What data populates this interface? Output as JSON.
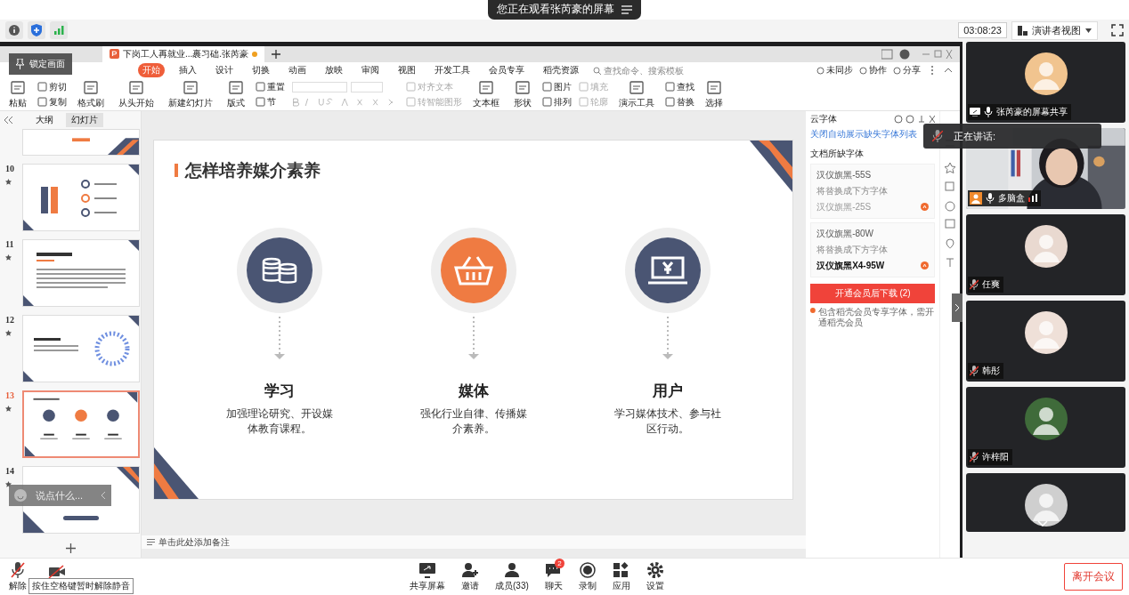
{
  "top_banner": {
    "text": "您正在观看张芮豪的屏幕"
  },
  "toolbar": {
    "time": "03:08:23",
    "view_button": "演讲者视图"
  },
  "lock_tooltip": "锁定画面",
  "wps": {
    "tabs": [
      {
        "label": "下岗工人再就业...裹习础.张芮豪",
        "selected": true
      }
    ],
    "menu": [
      {
        "label": "开始",
        "selected": true
      },
      {
        "label": "插入",
        "selected": false
      },
      {
        "label": "设计",
        "selected": false
      },
      {
        "label": "切换",
        "selected": false
      },
      {
        "label": "动画",
        "selected": false
      },
      {
        "label": "放映",
        "selected": false
      },
      {
        "label": "审阅",
        "selected": false
      },
      {
        "label": "视图",
        "selected": false
      },
      {
        "label": "开发工具",
        "selected": false
      },
      {
        "label": "会员专享",
        "selected": false
      },
      {
        "label": "稻壳资源",
        "selected": false
      }
    ],
    "search_placeholder": "查找命令、搜索模板",
    "header_actions": [
      "未同步",
      "协作",
      "分享"
    ],
    "ribbon": [
      {
        "kind": "large",
        "label": "粘贴",
        "disabled": false
      },
      {
        "kind": "stack",
        "items": [
          {
            "label": "剪切",
            "disabled": false
          },
          {
            "label": "复制",
            "disabled": false
          }
        ]
      },
      {
        "kind": "large",
        "label": "格式刷",
        "disabled": false
      },
      {
        "kind": "large",
        "label": "从头开始",
        "disabled": false
      },
      {
        "kind": "large",
        "label": "新建幻灯片",
        "disabled": false
      },
      {
        "kind": "large",
        "label": "版式",
        "disabled": false
      },
      {
        "kind": "stack",
        "items": [
          {
            "label": "重置",
            "disabled": false
          },
          {
            "label": "节",
            "disabled": false
          }
        ]
      },
      {
        "kind": "font"
      },
      {
        "kind": "stack",
        "items": [
          {
            "label": "对齐文本",
            "disabled": true
          },
          {
            "label": "转智能图形",
            "disabled": true
          }
        ]
      },
      {
        "kind": "large",
        "label": "文本框",
        "disabled": false
      },
      {
        "kind": "large",
        "label": "形状",
        "disabled": false
      },
      {
        "kind": "stack",
        "items": [
          {
            "label": "图片",
            "disabled": false
          },
          {
            "label": "排列",
            "disabled": false
          }
        ]
      },
      {
        "kind": "stack",
        "items": [
          {
            "label": "填充",
            "disabled": true
          },
          {
            "label": "轮廓",
            "disabled": true
          }
        ]
      },
      {
        "kind": "large",
        "label": "演示工具",
        "disabled": false
      },
      {
        "kind": "stack",
        "items": [
          {
            "label": "查找",
            "disabled": false
          },
          {
            "label": "替换",
            "disabled": false
          }
        ]
      },
      {
        "kind": "large",
        "label": "选择",
        "disabled": false
      }
    ],
    "panel_tabs": [
      {
        "label": "大纲",
        "selected": false
      },
      {
        "label": "幻灯片",
        "selected": true
      }
    ],
    "thumbnails": [
      {
        "kind": "cover",
        "selected": false
      },
      {
        "number": "10",
        "kind": "people",
        "selected": false
      },
      {
        "number": "11",
        "kind": "text",
        "selected": false
      },
      {
        "number": "12",
        "kind": "loading",
        "selected": false
      },
      {
        "number": "13",
        "kind": "columns",
        "selected": true
      },
      {
        "number": "14",
        "kind": "thanks",
        "selected": false
      }
    ],
    "chat_overlay": "说点什么...",
    "slide": {
      "title": "怎样培养媒介素养",
      "items": [
        {
          "heading": "学习",
          "text": "加强理论研究、开设媒体教育课程。",
          "kind": "coins",
          "color": "#4a5573"
        },
        {
          "heading": "媒体",
          "text": "强化行业自律、传播媒介素养。",
          "kind": "basket",
          "color": "#ef7b42"
        },
        {
          "heading": "用户",
          "text": "学习媒体技术、参与社区行动。",
          "kind": "computer",
          "color": "#4a5573"
        }
      ]
    },
    "notes_placeholder": "单击此处添加备注",
    "font_panel": {
      "title": "云字体",
      "link": "关闭自动展示缺失字体列表",
      "section": "文档所缺字体",
      "fonts": [
        {
          "missing": "汉仪旗黑-55S",
          "hint": "将替换成下方字体",
          "replacement": "汉仪旗黑-25S",
          "available": false
        },
        {
          "missing": "汉仪旗黑-80W",
          "hint": "将替换成下方字体",
          "replacement": "汉仪旗黑X4-95W",
          "available": true
        }
      ],
      "button": "开通会员后下载 (2)",
      "note": "包含稻壳会员专享字体，需开通稻壳会员"
    }
  },
  "speaking": "正在讲话:",
  "participants": [
    {
      "name": "张芮豪的屏幕共享",
      "kind": "screen",
      "muted": false
    },
    {
      "name": "多脑盒",
      "kind": "camera",
      "muted": false
    },
    {
      "name": "任爽",
      "kind": "avatar",
      "muted": true
    },
    {
      "name": "韩彤",
      "kind": "avatar",
      "muted": true
    },
    {
      "name": "许梓阳",
      "kind": "avatar",
      "muted": true
    },
    {
      "kind": "avatar"
    }
  ],
  "bottom_bar": {
    "mute_label": "解除",
    "mute_tooltip": "按住空格键暂时解除静音",
    "muted": true,
    "buttons": [
      {
        "label": "共享屏幕",
        "kind": "share"
      },
      {
        "label": "邀请",
        "kind": "invite"
      },
      {
        "label": "成员(33)",
        "kind": "members"
      },
      {
        "label": "聊天",
        "kind": "chat",
        "badge": "2"
      },
      {
        "label": "录制",
        "kind": "record"
      },
      {
        "label": "应用",
        "kind": "apps"
      },
      {
        "label": "设置",
        "kind": "settings"
      }
    ],
    "leave": "离开会议"
  }
}
